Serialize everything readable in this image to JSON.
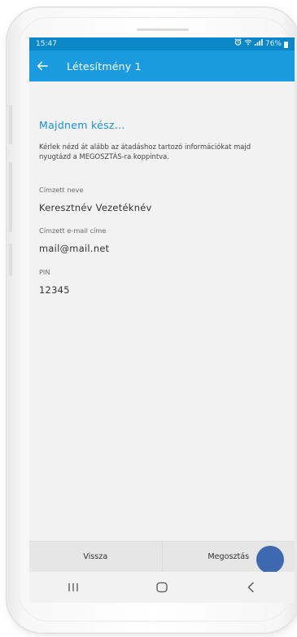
{
  "status_bar": {
    "time": "15:47",
    "battery": "76%",
    "signal_text": "·∙ıl"
  },
  "app_bar": {
    "title": "Létesítmény 1"
  },
  "main": {
    "heading": "Majdnem kész...",
    "intro": "Kérlek nézd át alább az átadáshoz tartozó információkat majd nyugtázd a MEGOSZTÁS-ra koppintva.",
    "fields": [
      {
        "label": "Címzett neve",
        "value": "Keresztnév Vezetéknév"
      },
      {
        "label": "Címzett e-mail címe",
        "value": "mail@mail.net"
      },
      {
        "label": "PIN",
        "value": "12345"
      }
    ]
  },
  "actions": {
    "back_label": "Vissza",
    "share_label": "Megosztás"
  },
  "nav": {
    "icons": [
      "recent-apps-icon",
      "home-icon",
      "back-icon"
    ]
  },
  "colors": {
    "status_bar": "#0b86c6",
    "app_bar": "#1a9be0",
    "accent_text": "#1a8fd8",
    "touch_indicator": "#3e68b0",
    "screen_background": "#f2f2f2"
  }
}
